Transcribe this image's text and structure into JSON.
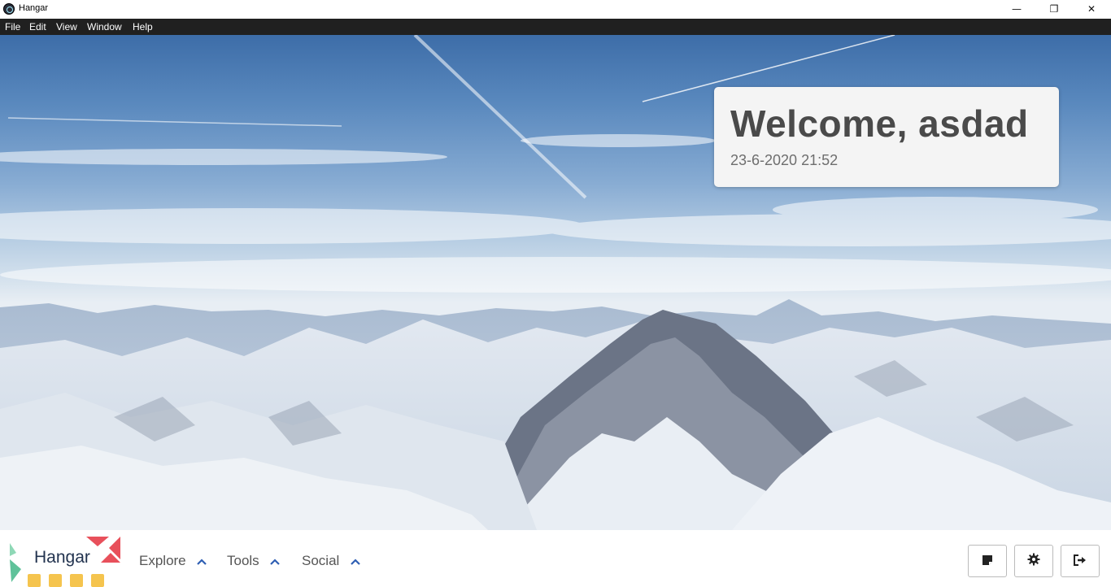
{
  "window": {
    "title": "Hangar",
    "controls": {
      "minimize": "—",
      "maximize": "❐",
      "close": "✕"
    }
  },
  "menubar": {
    "items": [
      "File",
      "Edit",
      "View",
      "Window",
      "Help"
    ]
  },
  "hero": {
    "image": "mountain-landscape"
  },
  "welcome": {
    "title": "Welcome, asdad",
    "datetime": "23-6-2020 21:52"
  },
  "bottombar": {
    "logo_text": "Hangar",
    "nav": [
      {
        "label": "Explore",
        "icon": "chevron-up-icon"
      },
      {
        "label": "Tools",
        "icon": "chevron-up-icon"
      },
      {
        "label": "Social",
        "icon": "chevron-up-icon"
      }
    ],
    "actions": [
      {
        "icon": "note-icon"
      },
      {
        "icon": "gear-icon"
      },
      {
        "icon": "logout-icon"
      }
    ]
  },
  "colors": {
    "menubar_bg": "#202020",
    "accent_blue": "#2f5fb3",
    "logo_red": "#e8505b",
    "logo_green": "#5fc29a",
    "logo_yellow": "#f5c44e"
  }
}
